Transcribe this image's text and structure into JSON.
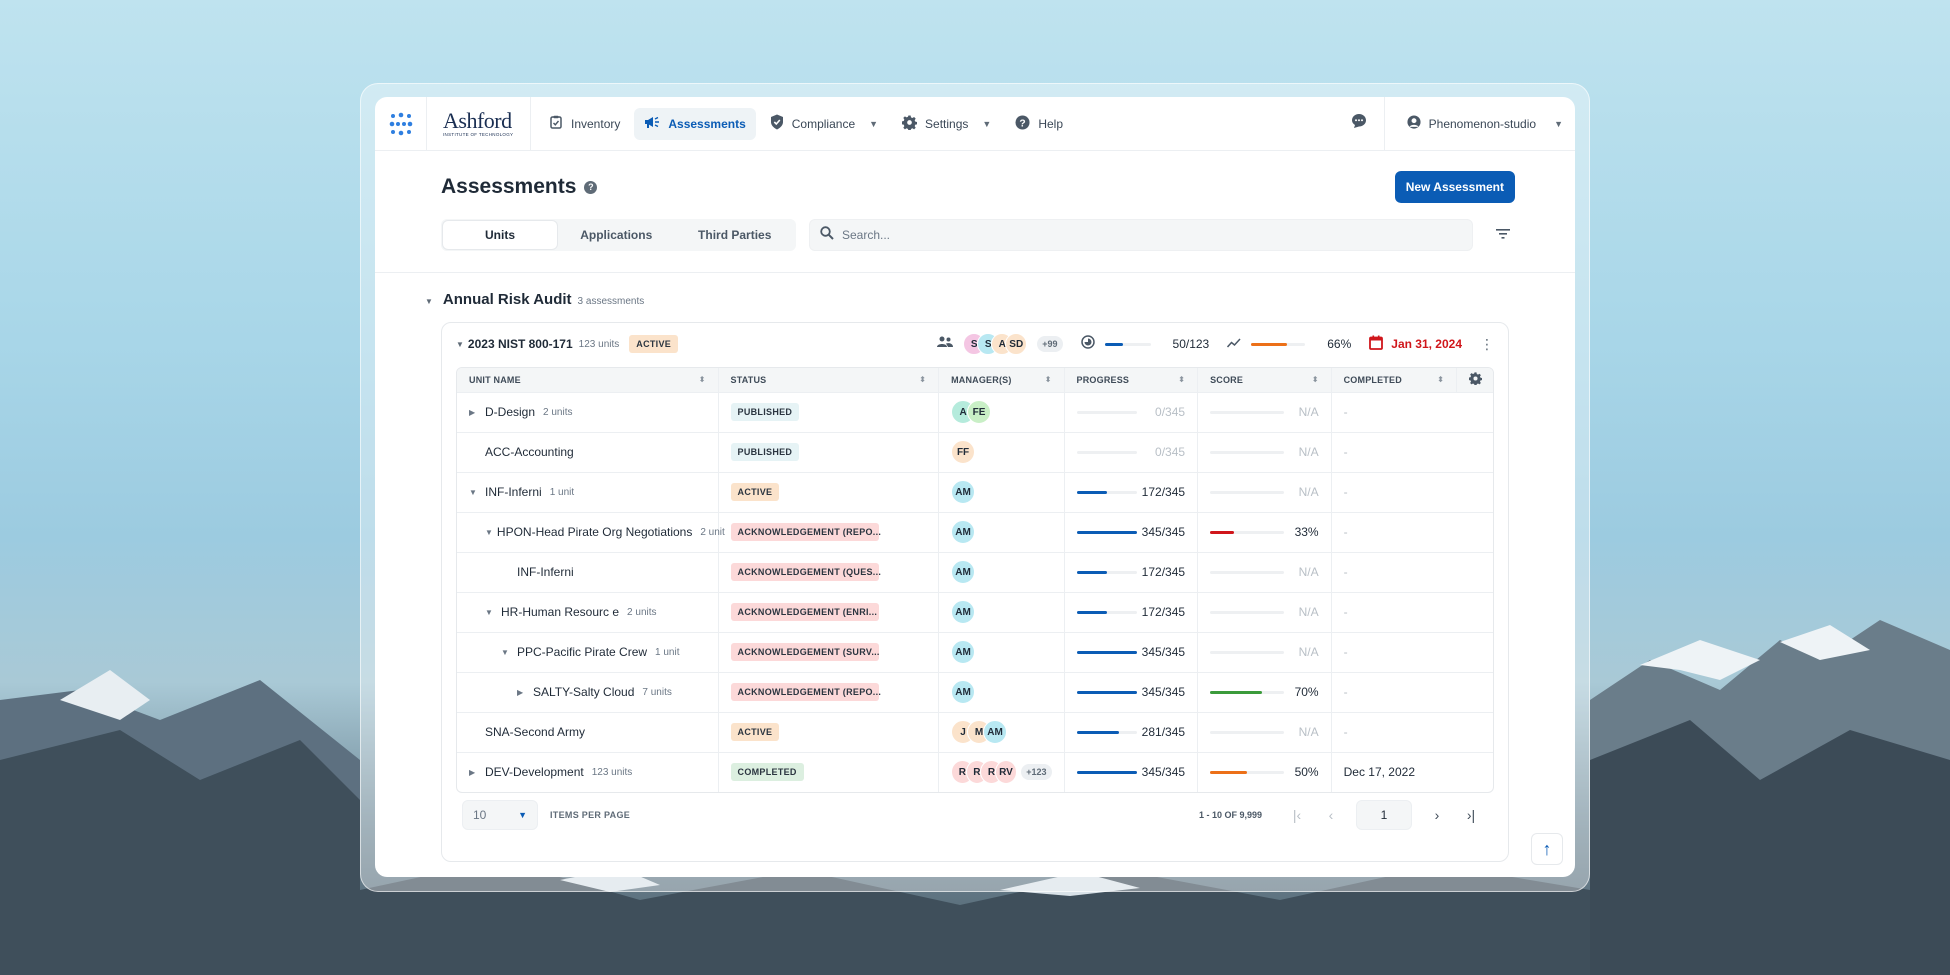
{
  "colors": {
    "primary": "#0b5cb5",
    "progress": "#0b5cb5",
    "score_red": "#d0161b",
    "score_green": "#3b9b3b",
    "score_orange": "#ec7018",
    "due_red": "#d0161b"
  },
  "nav": {
    "logo_icon": "dots-logo-icon",
    "brand_name": "Ashford",
    "brand_sub": "INSTITUTE OF TECHNOLOGY",
    "items": [
      {
        "label": "Inventory",
        "icon": "clipboard-check-icon",
        "active": false,
        "dropdown": false
      },
      {
        "label": "Assessments",
        "icon": "megaphone-icon",
        "active": true,
        "dropdown": false
      },
      {
        "label": "Compliance",
        "icon": "shield-check-icon",
        "active": false,
        "dropdown": true
      },
      {
        "label": "Settings",
        "icon": "gear-icon",
        "active": false,
        "dropdown": true
      },
      {
        "label": "Help",
        "icon": "question-circle-icon",
        "active": false,
        "dropdown": false
      }
    ],
    "chat_icon": "chat-bubble-icon",
    "user": {
      "name": "Phenomenon-studio",
      "icon": "user-icon"
    }
  },
  "header": {
    "title": "Assessments",
    "help_icon": "?",
    "new_button": "New Assessment",
    "tabs": [
      {
        "label": "Units",
        "active": true
      },
      {
        "label": "Applications",
        "active": false
      },
      {
        "label": "Third Parties",
        "active": false
      }
    ],
    "search_placeholder": "Search...",
    "search_value": ""
  },
  "group": {
    "title": "Annual Risk Audit",
    "count": "3 assessments",
    "assessment": {
      "title": "2023 NIST 800-171",
      "units": "123 units",
      "status": "ACTIVE",
      "managers": [
        {
          "initials": "S",
          "color": "#f4c6e3"
        },
        {
          "initials": "S",
          "color": "#b8e8f2"
        },
        {
          "initials": "A",
          "color": "#fbe3cb"
        },
        {
          "initials": "SD",
          "color": "#fbe3cb"
        }
      ],
      "managers_more": "+99",
      "progress_text": "50/123",
      "progress_fraction": 0.41,
      "score_text": "66%",
      "score_fraction": 0.66,
      "due_date": "Jan 31, 2024"
    }
  },
  "table": {
    "columns": [
      "UNIT NAME",
      "STATUS",
      "MANAGER(S)",
      "PROGRESS",
      "SCORE",
      "COMPLETED"
    ],
    "rows": [
      {
        "name": "D-Design",
        "units": "2 units",
        "level": 0,
        "toggle": "collapsed",
        "status": "PUBLISHED",
        "status_type": "published",
        "managers": [
          {
            "initials": "A",
            "color": "#b5ebdc"
          },
          {
            "initials": "FE",
            "color": "#c9efc6"
          }
        ],
        "more": "",
        "progress": "0/345",
        "progress_fraction": 0,
        "score": "N/A",
        "score_fraction": 0,
        "score_color": "",
        "completed": "-"
      },
      {
        "name": "ACC-Accounting",
        "units": "",
        "level": 0,
        "toggle": "none",
        "status": "PUBLISHED",
        "status_type": "published",
        "managers": [
          {
            "initials": "FF",
            "color": "#fbe3cb"
          }
        ],
        "more": "",
        "progress": "0/345",
        "progress_fraction": 0,
        "score": "N/A",
        "score_fraction": 0,
        "score_color": "",
        "completed": "-"
      },
      {
        "name": "INF-Inferni",
        "units": "1 unit",
        "level": 0,
        "toggle": "expanded",
        "status": "ACTIVE",
        "status_type": "active",
        "managers": [
          {
            "initials": "AM",
            "color": "#b8e8f2"
          }
        ],
        "more": "",
        "progress": "172/345",
        "progress_fraction": 0.5,
        "score": "N/A",
        "score_fraction": 0,
        "score_color": "",
        "completed": "-"
      },
      {
        "name": "HPON-Head Pirate Org Negotiations",
        "units": "2 unit",
        "level": 1,
        "toggle": "expanded",
        "status": "ACKNOWLEDGEMENT (REPO...",
        "status_type": "ack",
        "managers": [
          {
            "initials": "AM",
            "color": "#b8e8f2"
          }
        ],
        "more": "",
        "progress": "345/345",
        "progress_fraction": 1,
        "score": "33%",
        "score_fraction": 0.33,
        "score_color": "#d0161b",
        "completed": "-"
      },
      {
        "name": "INF-Inferni",
        "units": "",
        "level": 2,
        "toggle": "none",
        "status": "ACKNOWLEDGEMENT (QUES...",
        "status_type": "ack",
        "managers": [
          {
            "initials": "AM",
            "color": "#b8e8f2"
          }
        ],
        "more": "",
        "progress": "172/345",
        "progress_fraction": 0.5,
        "score": "N/A",
        "score_fraction": 0,
        "score_color": "",
        "completed": "-"
      },
      {
        "name": "HR-Human Resourc e",
        "units": "2 units",
        "level": 1,
        "toggle": "expanded",
        "status": "ACKNOWLEDGEMENT (ENRI...",
        "status_type": "ack",
        "managers": [
          {
            "initials": "AM",
            "color": "#b8e8f2"
          }
        ],
        "more": "",
        "progress": "172/345",
        "progress_fraction": 0.5,
        "score": "N/A",
        "score_fraction": 0,
        "score_color": "",
        "completed": "-"
      },
      {
        "name": "PPC-Pacific Pirate Crew",
        "units": "1 unit",
        "level": 2,
        "toggle": "expanded",
        "status": "ACKNOWLEDGEMENT (SURV...",
        "status_type": "ack",
        "managers": [
          {
            "initials": "AM",
            "color": "#b8e8f2"
          }
        ],
        "more": "",
        "progress": "345/345",
        "progress_fraction": 1,
        "score": "N/A",
        "score_fraction": 0,
        "score_color": "",
        "completed": "-"
      },
      {
        "name": "SALTY-Salty Cloud",
        "units": "7 units",
        "level": 3,
        "toggle": "collapsed",
        "status": "ACKNOWLEDGEMENT (REPO...",
        "status_type": "ack",
        "managers": [
          {
            "initials": "AM",
            "color": "#b8e8f2"
          }
        ],
        "more": "",
        "progress": "345/345",
        "progress_fraction": 1,
        "score": "70%",
        "score_fraction": 0.7,
        "score_color": "#3b9b3b",
        "completed": "-"
      },
      {
        "name": "SNA-Second Army",
        "units": "",
        "level": 0,
        "toggle": "none",
        "status": "ACTIVE",
        "status_type": "active",
        "managers": [
          {
            "initials": "J",
            "color": "#fbe3cb"
          },
          {
            "initials": "M",
            "color": "#fbe3cb"
          },
          {
            "initials": "AM",
            "color": "#b8e8f2"
          }
        ],
        "more": "",
        "progress": "281/345",
        "progress_fraction": 0.7,
        "score": "N/A",
        "score_fraction": 0,
        "score_color": "",
        "completed": "-"
      },
      {
        "name": "DEV-Development",
        "units": "123 units",
        "level": 0,
        "toggle": "collapsed",
        "status": "COMPLETED",
        "status_type": "completed",
        "managers": [
          {
            "initials": "R",
            "color": "#fcd9d9"
          },
          {
            "initials": "R",
            "color": "#fcd9d9"
          },
          {
            "initials": "R",
            "color": "#fcd9d9"
          },
          {
            "initials": "RV",
            "color": "#fcd9d9"
          }
        ],
        "more": "+123",
        "progress": "345/345",
        "progress_fraction": 1,
        "score": "50%",
        "score_fraction": 0.5,
        "score_color": "#ec7018",
        "completed": "Dec 17, 2022"
      }
    ]
  },
  "pagination": {
    "per_page": "10",
    "per_page_label": "ITEMS PER PAGE",
    "range": "1 - 10 OF 9,999",
    "current_page": "1"
  }
}
